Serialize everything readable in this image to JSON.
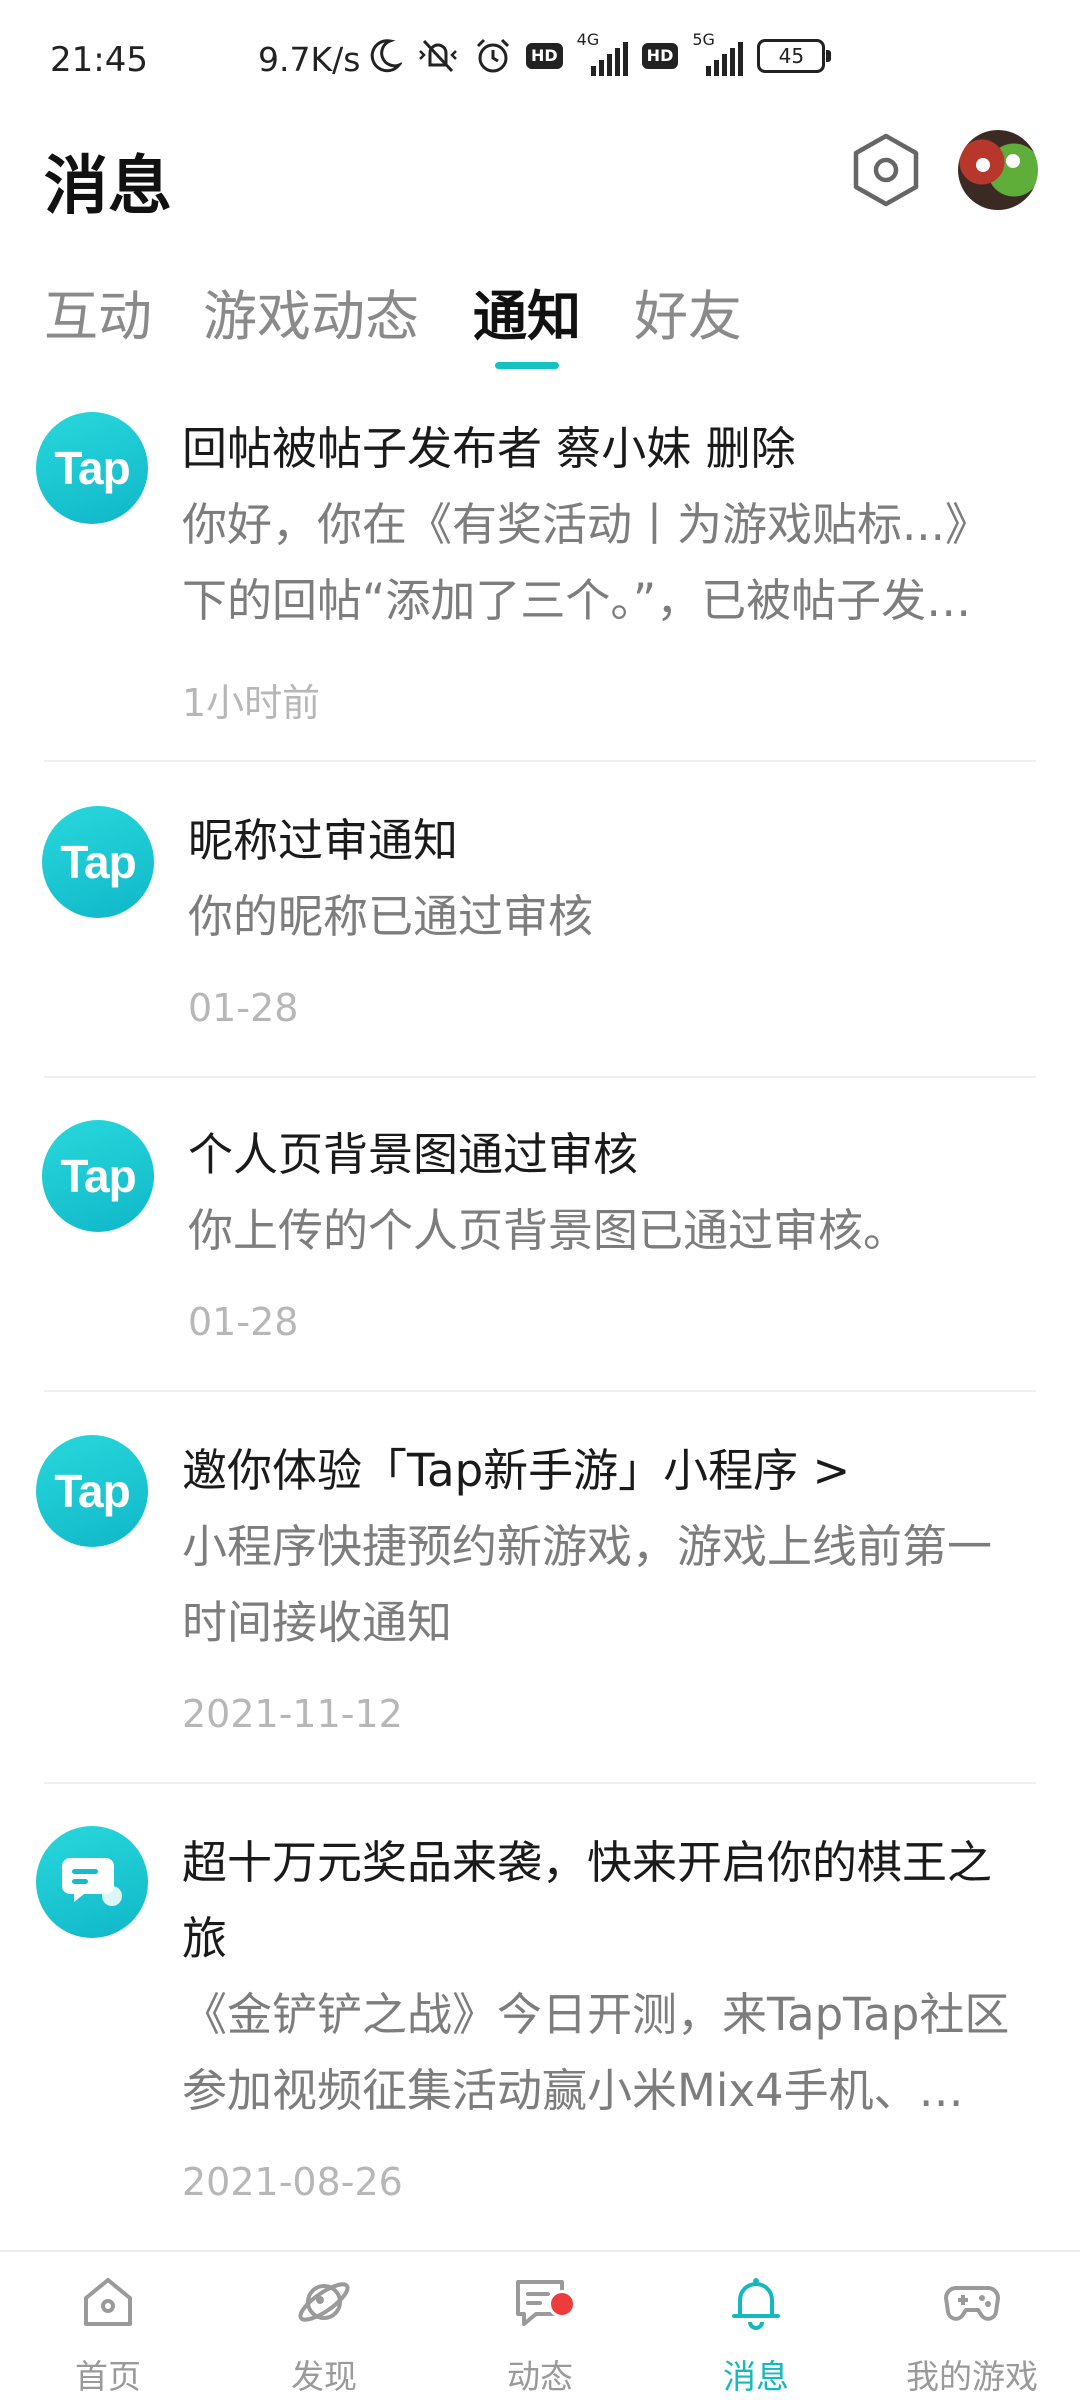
{
  "status_bar": {
    "time": "21:45",
    "speed": "9.7K/s",
    "hd_label": "HD",
    "network_1": "4G",
    "network_2": "5G",
    "battery": "45"
  },
  "header": {
    "title": "消息",
    "settings_icon": "gear-hex-icon",
    "avatar_icon": "avatar"
  },
  "tabs": [
    {
      "label": "互动",
      "active": false
    },
    {
      "label": "游戏动态",
      "active": false
    },
    {
      "label": "通知",
      "active": true
    },
    {
      "label": "好友",
      "active": false
    }
  ],
  "notifications": [
    {
      "icon": "Tap",
      "title": "回帖被帖子发布者 蔡小妹 删除",
      "body_line1": "你好，你在《有奖活动丨为游戏贴标...》",
      "body_line2": "下的回帖“添加了三个。”，已被帖子发…",
      "time": "1小时前"
    },
    {
      "icon": "Tap",
      "title": "昵称过审通知",
      "body_line1": "你的昵称已通过审核",
      "time": "01-28"
    },
    {
      "icon": "Tap",
      "title": "个人页背景图通过审核",
      "body_line1": "你上传的个人页背景图已通过审核。",
      "time": "01-28"
    },
    {
      "icon": "Tap",
      "title": "邀你体验「Tap新手游」小程序 >",
      "body_line1": "小程序快捷预约新游戏，游戏上线前第一",
      "body_line2": "时间接收通知",
      "time": "2021-11-12"
    },
    {
      "icon": "chat-bubble-icon",
      "title_line1": "超十万元奖品来袭，快来开启你的棋王之",
      "title_line2": "旅",
      "body_line1": "《金铲铲之战》今日开测，来TapTap社区",
      "body_line2": "参加视频征集活动赢小米Mix4手机、…",
      "time": "2021-08-26"
    }
  ],
  "bottom_nav": [
    {
      "label": "首页",
      "icon": "home-icon",
      "active": false
    },
    {
      "label": "发现",
      "icon": "planet-icon",
      "active": false
    },
    {
      "label": "动态",
      "icon": "message-icon",
      "active": false,
      "badge": true
    },
    {
      "label": "消息",
      "icon": "bell-icon",
      "active": true
    },
    {
      "label": "我的游戏",
      "icon": "gamepad-icon",
      "active": false
    }
  ],
  "colors": {
    "accent": "#14c2c1",
    "tap_icon": "#1bc6d4",
    "badge": "#ee3b3b"
  }
}
